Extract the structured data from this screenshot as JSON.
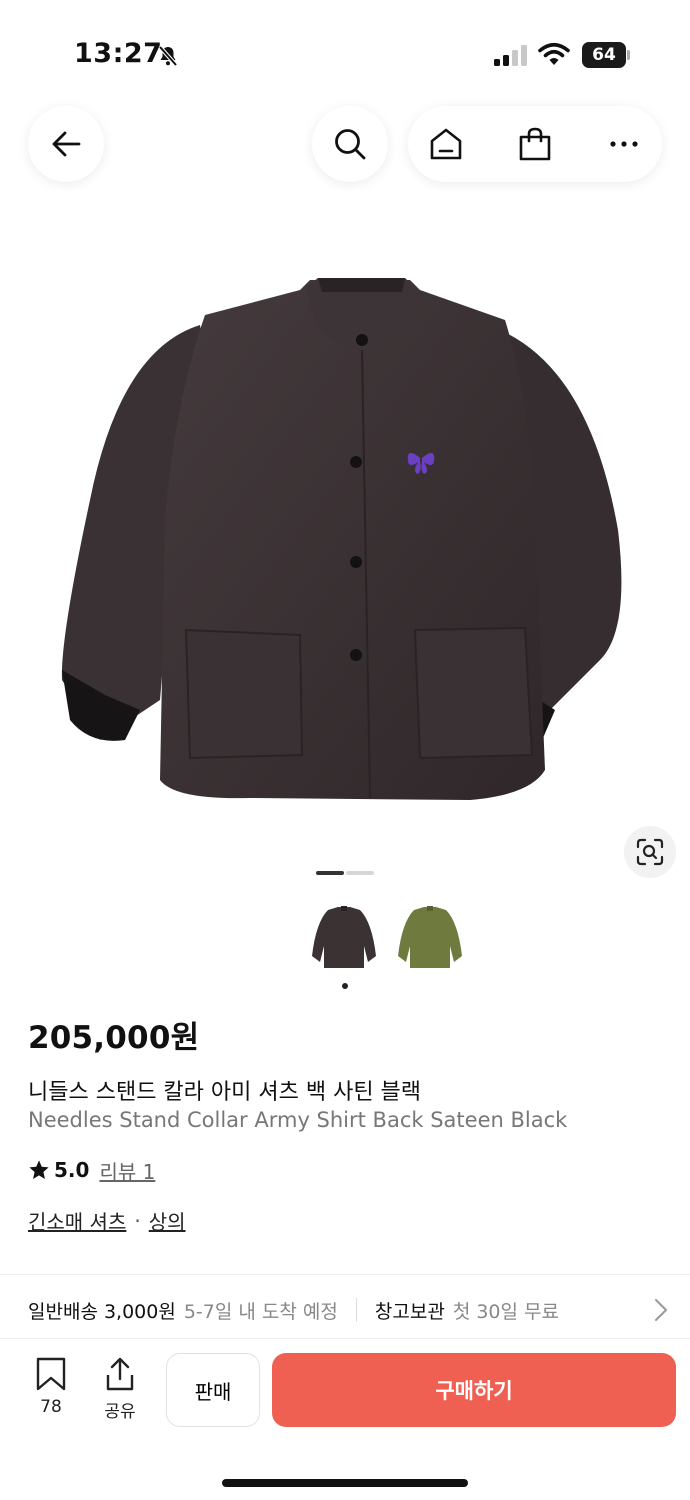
{
  "status_bar": {
    "time": "13:27",
    "battery": "64"
  },
  "product": {
    "price": "205,000원",
    "name_ko": "니들스 스탠드 칼라 아미 셔츠 백 사틴 블랙",
    "name_en": "Needles Stand Collar Army Shirt Back Sateen Black",
    "rating": "5.0",
    "review_link": "리뷰 1",
    "category_primary": "긴소매 셔츠",
    "category_separator": "·",
    "category_secondary": "상의"
  },
  "gallery": {
    "current_page": 1,
    "total_pages": 2,
    "thumbnails": [
      "black-jacket",
      "olive-jacket"
    ]
  },
  "shipping": {
    "label": "일반배송 3,000원",
    "eta": "5-7일 내 도착 예정",
    "storage_label": "창고보관",
    "storage_note": "첫 30일 무료"
  },
  "bottom_bar": {
    "bookmark_count": "78",
    "share_label": "공유",
    "sell_label": "판매",
    "buy_label": "구매하기"
  },
  "colors": {
    "buy_button": "#ef5f52",
    "jacket_main": "#3b3234",
    "jacket_alt": "#6e7a3e",
    "logo_purple": "#6a3fc2"
  }
}
